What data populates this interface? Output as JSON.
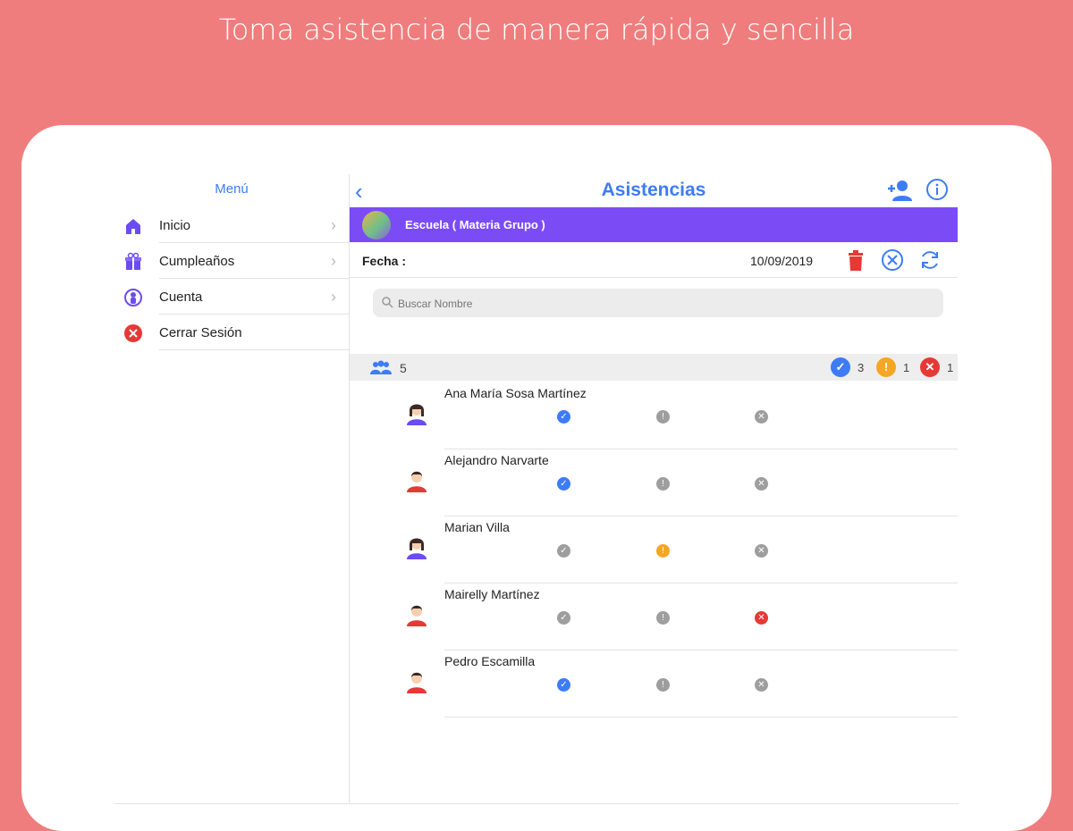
{
  "headline": "Toma asistencia de manera rápida y sencilla",
  "colors": {
    "background": "#ef7d7d",
    "accent": "#3d7cf5",
    "group_bar": "#7b4cf5",
    "present": "#3d7cf5",
    "late": "#f5a623",
    "absent": "#e53935",
    "inactive": "#9e9e9e"
  },
  "sidebar": {
    "title": "Menú",
    "items": [
      {
        "label": "Inicio",
        "icon": "home-icon"
      },
      {
        "label": "Cumpleaños",
        "icon": "gift-icon"
      },
      {
        "label": "Cuenta",
        "icon": "account-icon"
      },
      {
        "label": "Cerrar Sesión",
        "icon": "logout-icon"
      }
    ]
  },
  "nav": {
    "back": "‹",
    "title": "Asistencias"
  },
  "group": {
    "name": "Escuela ( Materia Grupo )"
  },
  "date_row": {
    "label": "Fecha :",
    "value": "10/09/2019"
  },
  "search": {
    "placeholder": "Buscar Nombre"
  },
  "summary": {
    "total": "5",
    "present": "3",
    "late": "1",
    "absent": "1"
  },
  "students": [
    {
      "name": "Ana María Sosa Martínez",
      "gender": "female",
      "status": "present"
    },
    {
      "name": "Alejandro Narvarte",
      "gender": "male",
      "status": "present"
    },
    {
      "name": "Marian Villa",
      "gender": "female",
      "status": "late"
    },
    {
      "name": "Mairelly Martínez",
      "gender": "male",
      "status": "absent"
    },
    {
      "name": "Pedro Escamilla",
      "gender": "male",
      "status": "present"
    }
  ]
}
